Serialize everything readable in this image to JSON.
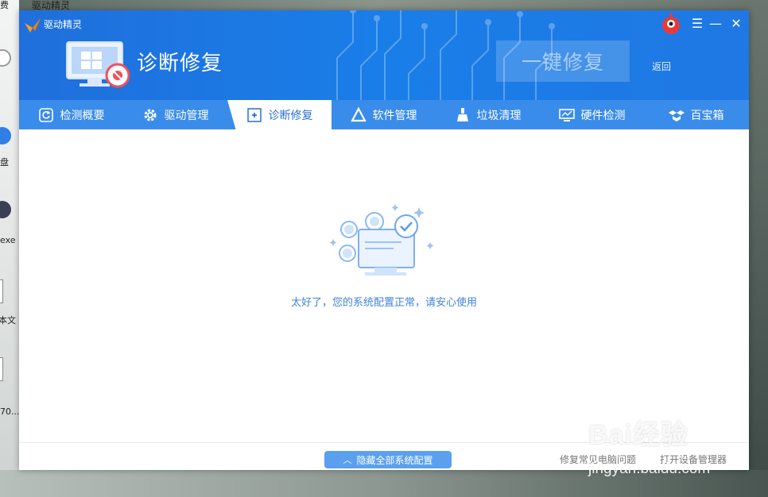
{
  "desktop": {
    "labels": [
      "费",
      "驱动精灵",
      "盘",
      "exe",
      "本文",
      "70..."
    ]
  },
  "window": {
    "app_title": "驱动精灵",
    "page_title": "诊断修复",
    "repair_button": "一键修复",
    "back_link": "返回"
  },
  "tabs": [
    {
      "label": "检测概要",
      "icon": "refresh-icon"
    },
    {
      "label": "驱动管理",
      "icon": "gear-icon"
    },
    {
      "label": "诊断修复",
      "icon": "diagnose-icon",
      "active": true
    },
    {
      "label": "软件管理",
      "icon": "triangle-logo-icon"
    },
    {
      "label": "垃圾清理",
      "icon": "broom-icon"
    },
    {
      "label": "硬件检测",
      "icon": "monitor-icon"
    },
    {
      "label": "百宝箱",
      "icon": "box-icon"
    }
  ],
  "content": {
    "status_message": "太好了，您的系统配置正常，请安心使用"
  },
  "footer": {
    "hide_all_button": "隐藏全部系统配置",
    "fix_common_link": "修复常见电脑问题",
    "device_manager_link": "打开设备管理器"
  },
  "watermark": {
    "brand": "Bai经验",
    "site": "jingyan.baidu.com"
  },
  "colors": {
    "header_blue": "#1a7ee8",
    "tab_blue": "#3a8cea",
    "accent_text": "#3f83d9"
  }
}
